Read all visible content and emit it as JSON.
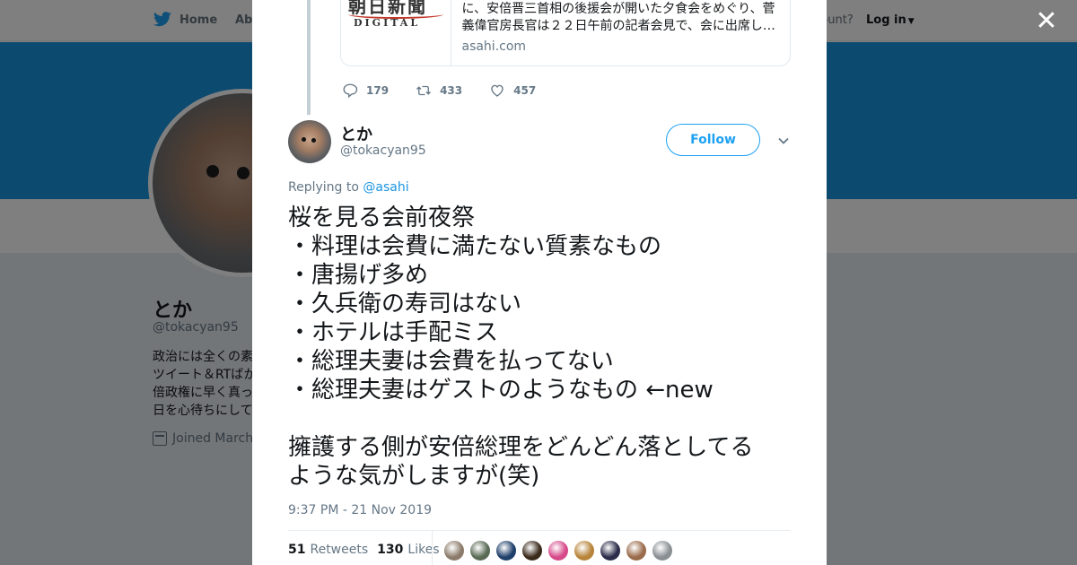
{
  "topnav": {
    "home_label": "Home",
    "about_label": "Abo",
    "account_prompt": "ccount?",
    "login_label": "Log in"
  },
  "profile": {
    "name": "とか",
    "handle": "@tokacyan95",
    "bio_lines": [
      "政治には全くの素",
      "ツイート＆RTばか",
      "倍政権に早く真っ",
      "日を心待ちにして"
    ],
    "joined": "Joined March"
  },
  "card": {
    "logo_text": "朝日新聞",
    "logo_sub": "DIGITAL",
    "desc_line1": "に、安倍晋三首相の後援会が開いた夕食会をめぐり、菅",
    "desc_line2": "義偉官房長官は２２日午前の記者会見で、会に出席し…",
    "domain": "asahi.com"
  },
  "parent_actions": {
    "replies": "179",
    "retweets": "433",
    "likes": "457"
  },
  "tweet": {
    "author_name": "とか",
    "author_handle": "@tokacyan95",
    "follow_label": "Follow",
    "replying_prefix": "Replying to",
    "replying_to": "@asahi",
    "lines": [
      "桜を見る会前夜祭",
      "・料理は会費に満たない質素なもの",
      "・唐揚げ多め",
      "・久兵衛の寿司はない",
      "・ホテルは手配ミス",
      "・総理夫妻は会費を払ってない",
      "・総理夫妻はゲストのようなもの ←new"
    ],
    "lines2": [
      "擁護する側が安倍総理をどんどん落としてる",
      "ような気がしますが(笑)"
    ],
    "timestamp": "9:37 PM - 21 Nov 2019",
    "retweet_count": "51",
    "retweet_label": "Retweets",
    "like_count": "130",
    "like_label": "Likes"
  },
  "likers": [
    "#8c7b6a",
    "#5a6b55",
    "#1f3f6b",
    "#3a2a1a",
    "#d64a8a",
    "#b8843a",
    "#2b2b4a",
    "#9a6b4a",
    "#8a8f94"
  ],
  "colors": {
    "accent": "#1da1f2",
    "banner": "#1b95e0",
    "thread_line": "#c4cfd6"
  },
  "icons": [
    "twitter-bird-icon",
    "caret-down-icon",
    "close-icon",
    "reply-icon",
    "retweet-icon",
    "heart-icon",
    "chevron-down-icon",
    "calendar-icon"
  ]
}
